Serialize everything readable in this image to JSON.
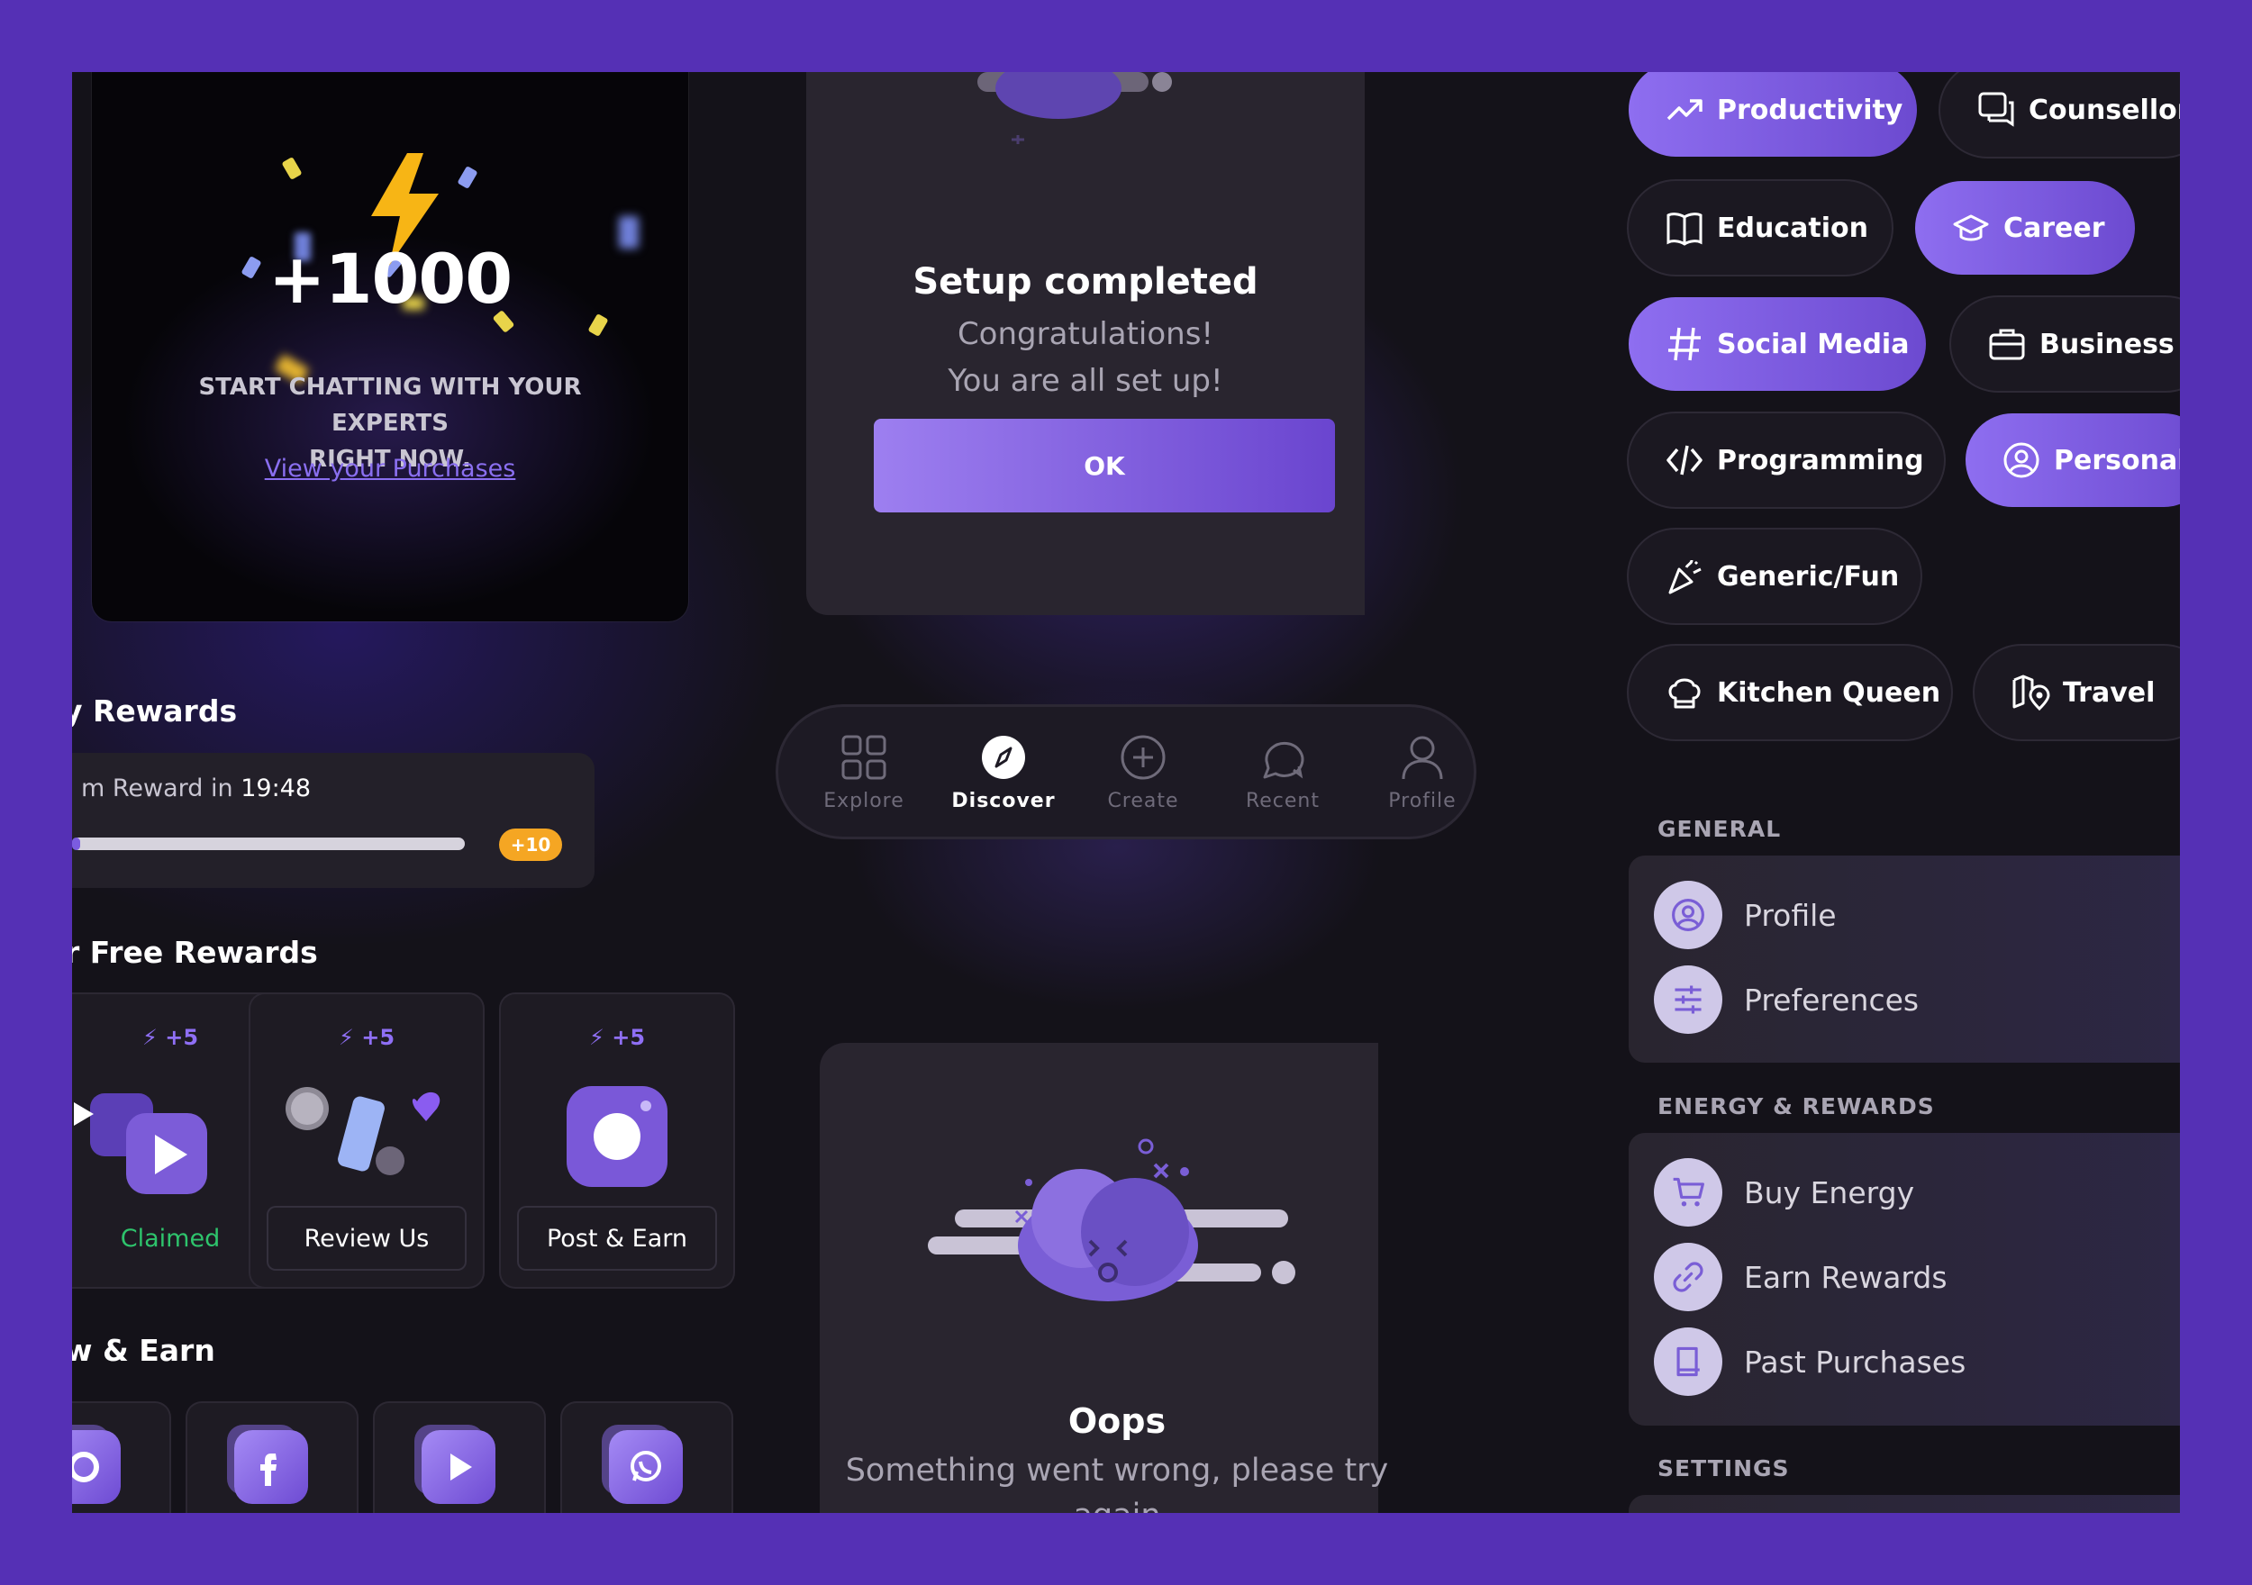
{
  "reward_card": {
    "amount": "+1000",
    "caption_line1": "START CHATTING WITH YOUR EXPERTS",
    "caption_line2": "RIGHT NOW.",
    "link": "View your Purchases"
  },
  "setup": {
    "title": "Setup completed",
    "line1": "Congratulations!",
    "line2": "You are all set up!",
    "ok_label": "OK"
  },
  "oops": {
    "title": "Oops",
    "line1": "Something went wrong, please try",
    "line2": "again"
  },
  "nav": {
    "items": [
      {
        "label": "Explore",
        "icon": "grid-icon"
      },
      {
        "label": "Discover",
        "icon": "compass-icon"
      },
      {
        "label": "Create",
        "icon": "plus-circle-icon"
      },
      {
        "label": "Recent",
        "icon": "chat-icon"
      },
      {
        "label": "Profile",
        "icon": "user-icon"
      }
    ],
    "active": "Discover"
  },
  "daily": {
    "title": "y Rewards",
    "prefix": "m Reward in ",
    "time": "19:48",
    "progress": 0.02,
    "badge": "+10"
  },
  "free": {
    "title": "r Free Rewards",
    "cards": [
      {
        "energy": "+5",
        "button": "Claimed",
        "claimed": true
      },
      {
        "energy": "+5",
        "button": "Review Us",
        "claimed": false
      },
      {
        "energy": "+5",
        "button": "Post & Earn",
        "claimed": false
      }
    ]
  },
  "follow": {
    "title": "w & Earn",
    "icons": [
      "instagram-icon",
      "facebook-icon",
      "youtube-icon",
      "whatsapp-icon"
    ]
  },
  "categories": [
    {
      "label": "Productivity",
      "icon": "trending-up-icon",
      "selected": true
    },
    {
      "label": "Counsellor",
      "icon": "chat-bubbles-icon",
      "selected": false
    },
    {
      "label": "Education",
      "icon": "book-icon",
      "selected": false
    },
    {
      "label": "Career",
      "icon": "graduation-cap-icon",
      "selected": true
    },
    {
      "label": "Social Media",
      "icon": "hashtag-icon",
      "selected": true
    },
    {
      "label": "Business",
      "icon": "briefcase-icon",
      "selected": false
    },
    {
      "label": "Programming",
      "icon": "code-icon",
      "selected": false
    },
    {
      "label": "Personal",
      "icon": "user-circle-icon",
      "selected": true
    },
    {
      "label": "Generic/Fun",
      "icon": "party-popper-icon",
      "selected": false
    },
    {
      "label": "Kitchen Queen",
      "icon": "chef-hat-icon",
      "selected": false
    },
    {
      "label": "Travel",
      "icon": "map-pin-icon",
      "selected": false
    }
  ],
  "settings": {
    "general_title": "GENERAL",
    "general": [
      {
        "label": "Profile",
        "icon": "user-circle-icon"
      },
      {
        "label": "Preferences",
        "icon": "sliders-icon"
      }
    ],
    "energy_title": "ENERGY & REWARDS",
    "energy": [
      {
        "label": "Buy Energy",
        "icon": "cart-icon"
      },
      {
        "label": "Earn Rewards",
        "icon": "link-icon"
      },
      {
        "label": "Past Purchases",
        "icon": "receipt-icon"
      }
    ],
    "settings_title": "SETTINGS"
  },
  "colors": {
    "frame": "#5530b5",
    "accent": "#8e6ef0",
    "background": "#141219",
    "success": "#2ec46c",
    "badge": "#f5a623"
  }
}
